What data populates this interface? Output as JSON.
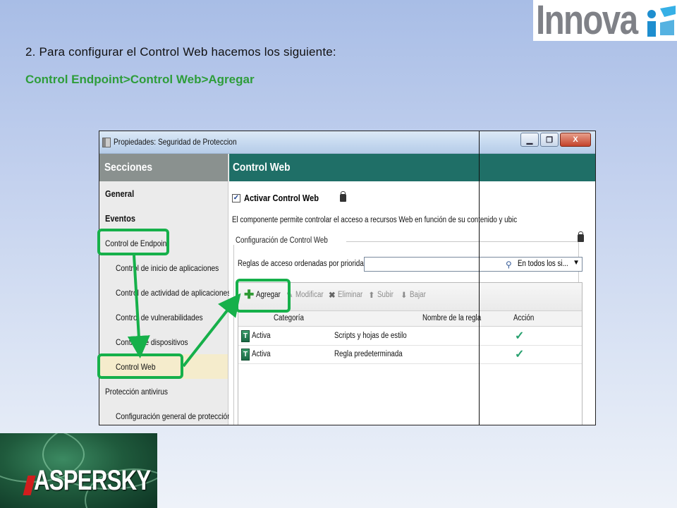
{
  "logo": {
    "text": "Innova",
    "icon": "innova-logo-icon"
  },
  "slide": {
    "title": "2. Para configurar el Control Web hacemos los siguiente:",
    "path": "Control Endpoint>Control Web>Agregar"
  },
  "window": {
    "title": "Propiedades: Seguridad de Proteccion",
    "buttons": {
      "minimize": "▁",
      "maximize": "❐",
      "close": "X"
    }
  },
  "sidebar": {
    "header": "Secciones",
    "items": [
      {
        "label": "General"
      },
      {
        "label": "Eventos"
      },
      {
        "label": "Control de Endpoint"
      },
      {
        "label": "Control de inicio de aplicaciones"
      },
      {
        "label": "Control de actividad de aplicaciones"
      },
      {
        "label": "Control de vulnerabilidades"
      },
      {
        "label": "Control de dispositivos"
      },
      {
        "label": "Control Web"
      },
      {
        "label": "Protección antivirus"
      },
      {
        "label": "Configuración general de protección"
      }
    ]
  },
  "main": {
    "header": "Control Web",
    "enable_label": "Activar Control Web",
    "enable_checked": true,
    "description": "El componente permite controlar el acceso a recursos Web en función de su contenido y ubic",
    "group_title": "Configuración de Control Web",
    "rules_label": "Reglas de acceso ordenadas por prioridad:",
    "search_value": "En todos los si...",
    "toolbar": {
      "add": "Agregar",
      "modify": "Modificar",
      "delete": "Eliminar",
      "up": "Subir",
      "down": "Bajar"
    },
    "columns": [
      "Categoría",
      "Nombre de la regla",
      "Acción"
    ],
    "rows": [
      {
        "category": "Activa",
        "name": "Scripts y hojas de estilo",
        "action": "✓"
      },
      {
        "category": "Activa",
        "name": "Regla predeterminada",
        "action": "✓"
      }
    ]
  },
  "kaspersky": {
    "brand": "ASPERSKY"
  },
  "colors": {
    "accent_green": "#16b04a",
    "header_teal": "#1f6f67",
    "sidebar_header": "#8a918f",
    "path_green": "#2e9d3a"
  }
}
